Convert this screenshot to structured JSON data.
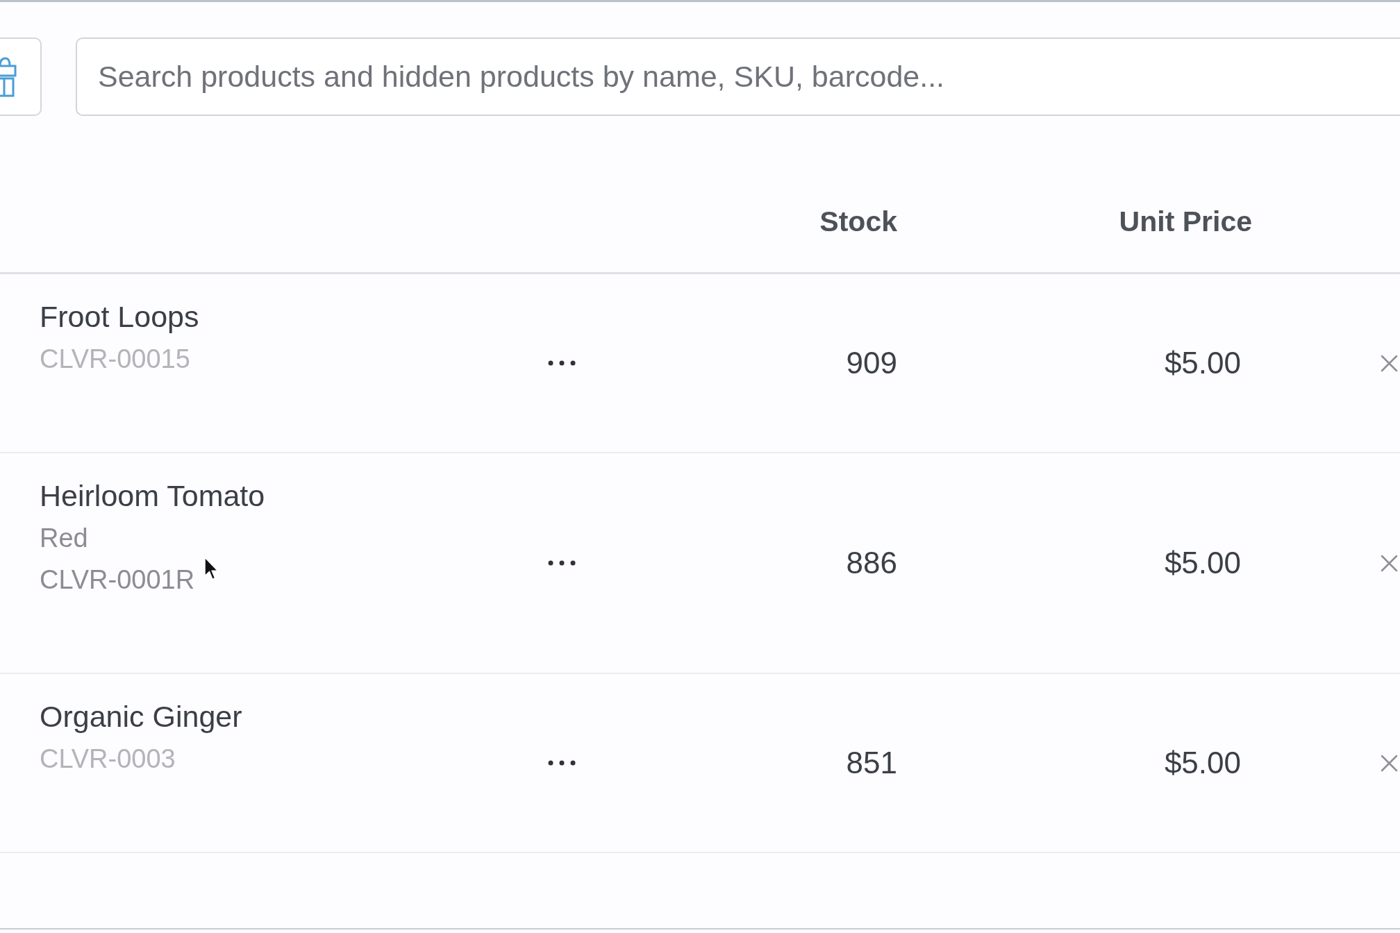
{
  "toolbar": {
    "search": {
      "placeholder": "Search products and hidden products by name, SKU, barcode..."
    }
  },
  "table": {
    "columns": [
      "Stock",
      "Unit Price"
    ],
    "rows": [
      {
        "name": "Froot Loops",
        "sku": "CLVR-00015",
        "stock": "909",
        "unit_price": "$5.00",
        "hovered": false
      },
      {
        "name": "Heirloom Tomato",
        "variant": "Red",
        "sku": "CLVR-0001R",
        "stock": "886",
        "unit_price": "$5.00",
        "hovered": true
      },
      {
        "name": "Organic Ginger",
        "sku": "CLVR-0003",
        "stock": "851",
        "unit_price": "$5.00",
        "hovered": false
      }
    ]
  }
}
